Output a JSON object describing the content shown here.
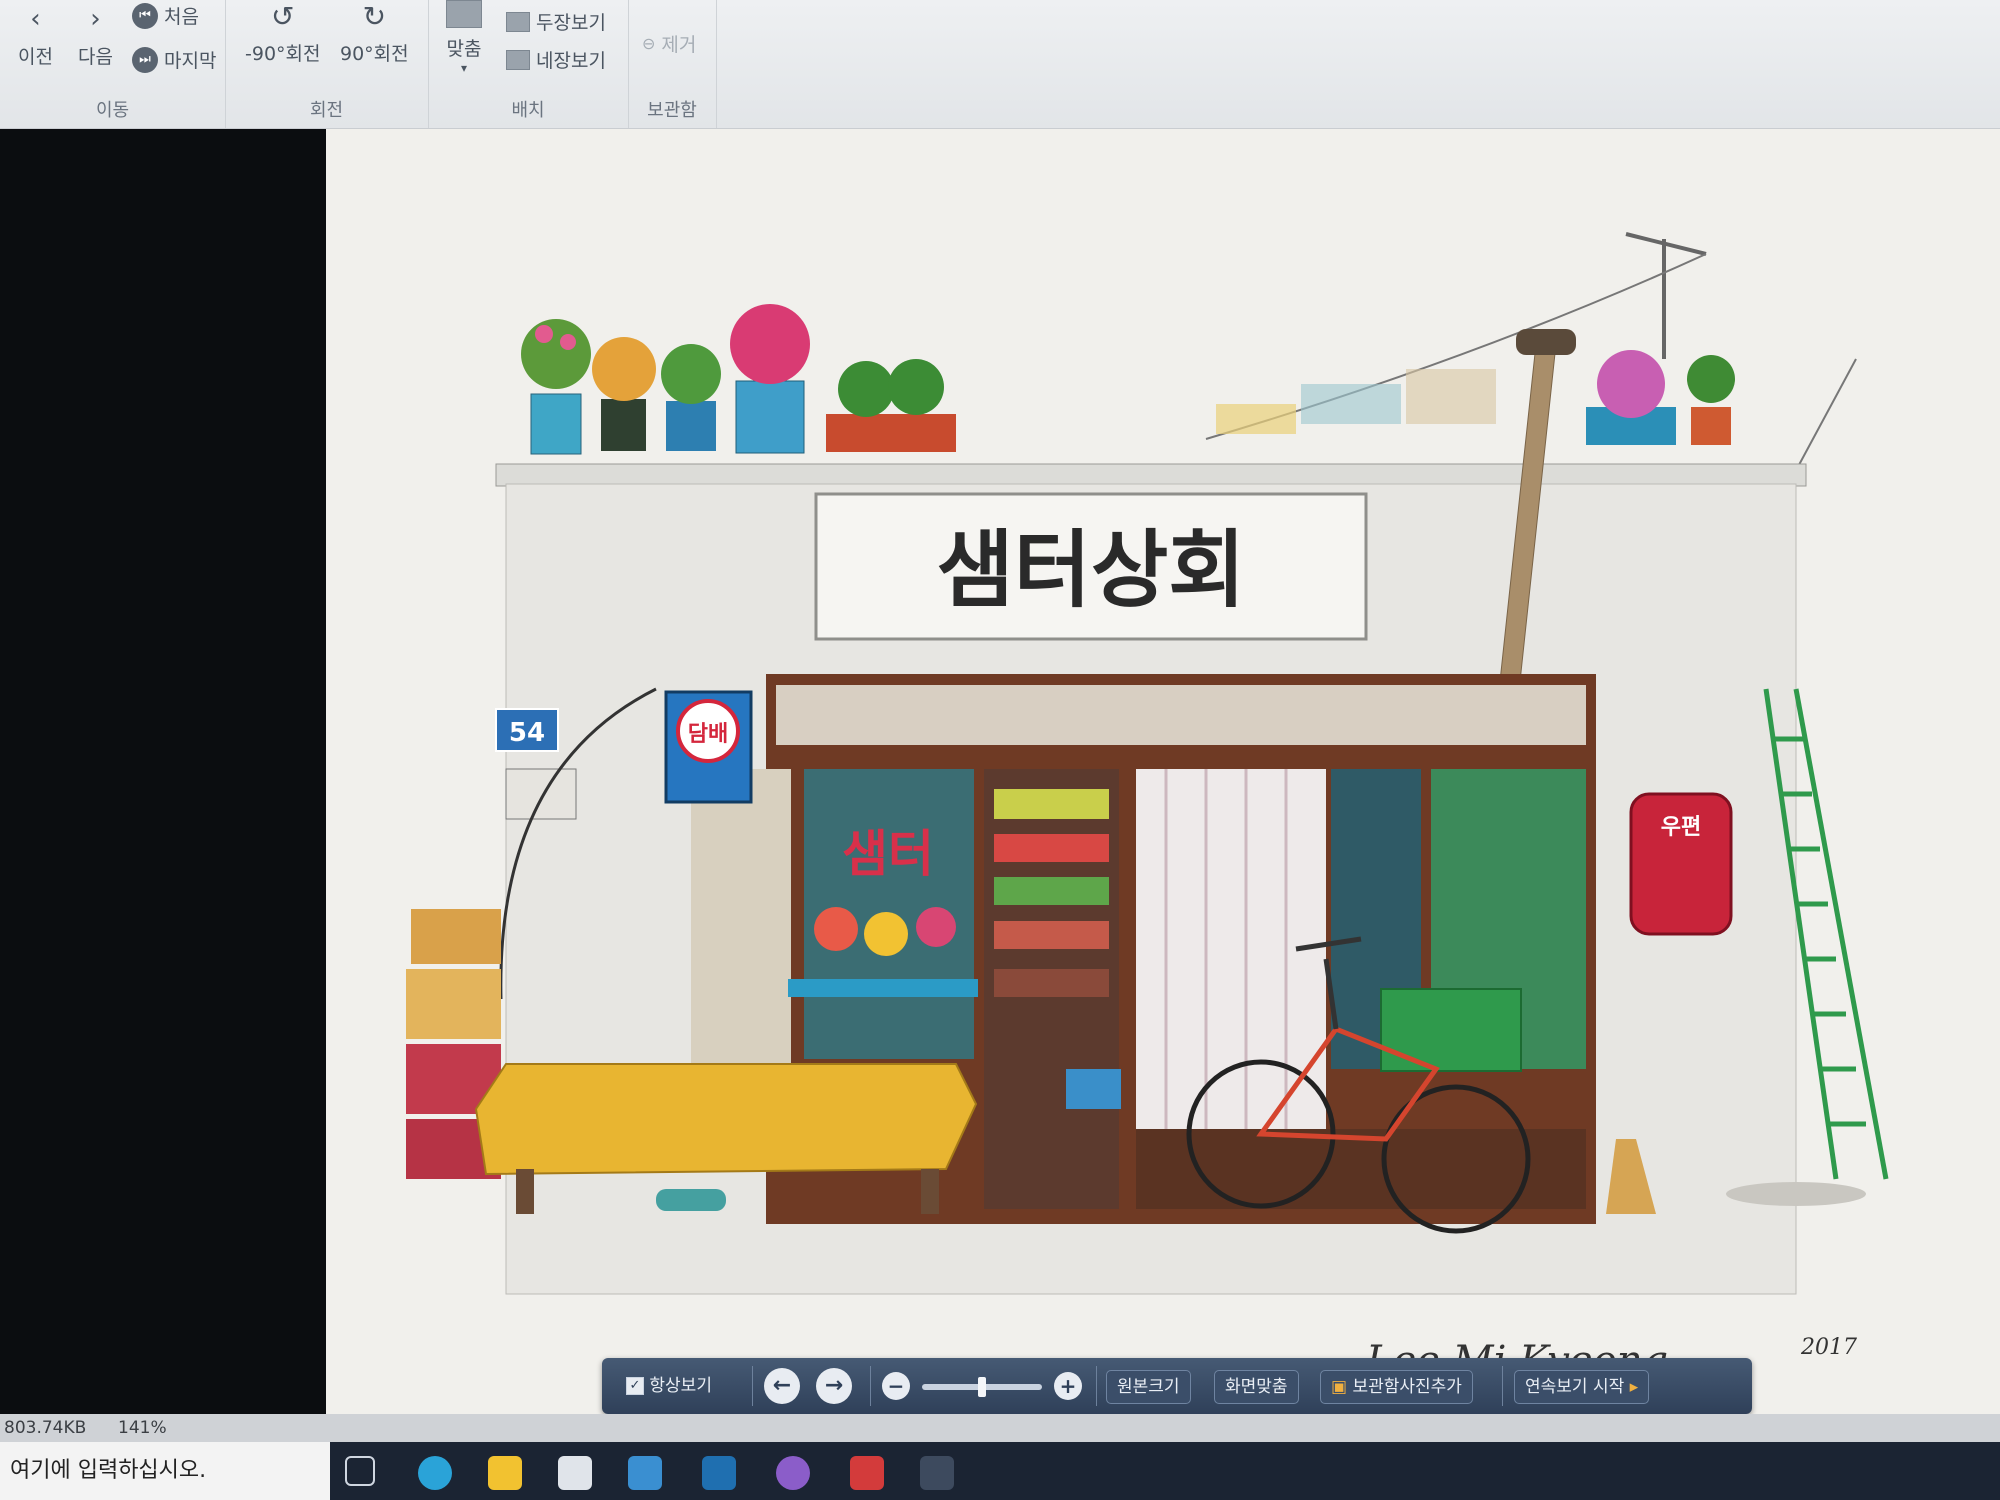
{
  "ribbon": {
    "move_group": {
      "prev": "이전",
      "next": "다음",
      "first": "처음",
      "last": "마지막",
      "label": "이동"
    },
    "rotate_group": {
      "ccw": "-90°회전",
      "cw": "90°회전",
      "label": "회전"
    },
    "layout_group": {
      "fit": "맞춤",
      "two_page": "두장보기",
      "four_page": "네장보기",
      "label": "배치"
    },
    "storage_group": {
      "remove": "제거",
      "label": "보관함"
    }
  },
  "image": {
    "shop_sign": "샘터상회",
    "window_sign": "샘터",
    "tobacco_sign": "담배",
    "house_number": "54",
    "post_box": "우편",
    "signature": "Lee Mi Kyeong",
    "year": "2017"
  },
  "viewer_toolbar": {
    "always_show": "항상보기",
    "original_size": "원본크기",
    "fit_screen": "화면맞춤",
    "add_to_storage": "보관함사진추가",
    "slideshow": "연속보기 시작",
    "zoom_level": 0.5
  },
  "status": {
    "file_size": "803.74KB",
    "zoom": "141%"
  },
  "taskbar": {
    "search_placeholder": "여기에 입력하십시오."
  },
  "colors": {
    "shop_frame": "#7a3b22",
    "bench_yellow": "#e8b531",
    "stair_green": "#2f9a4c",
    "postbox_red": "#c8243a"
  }
}
